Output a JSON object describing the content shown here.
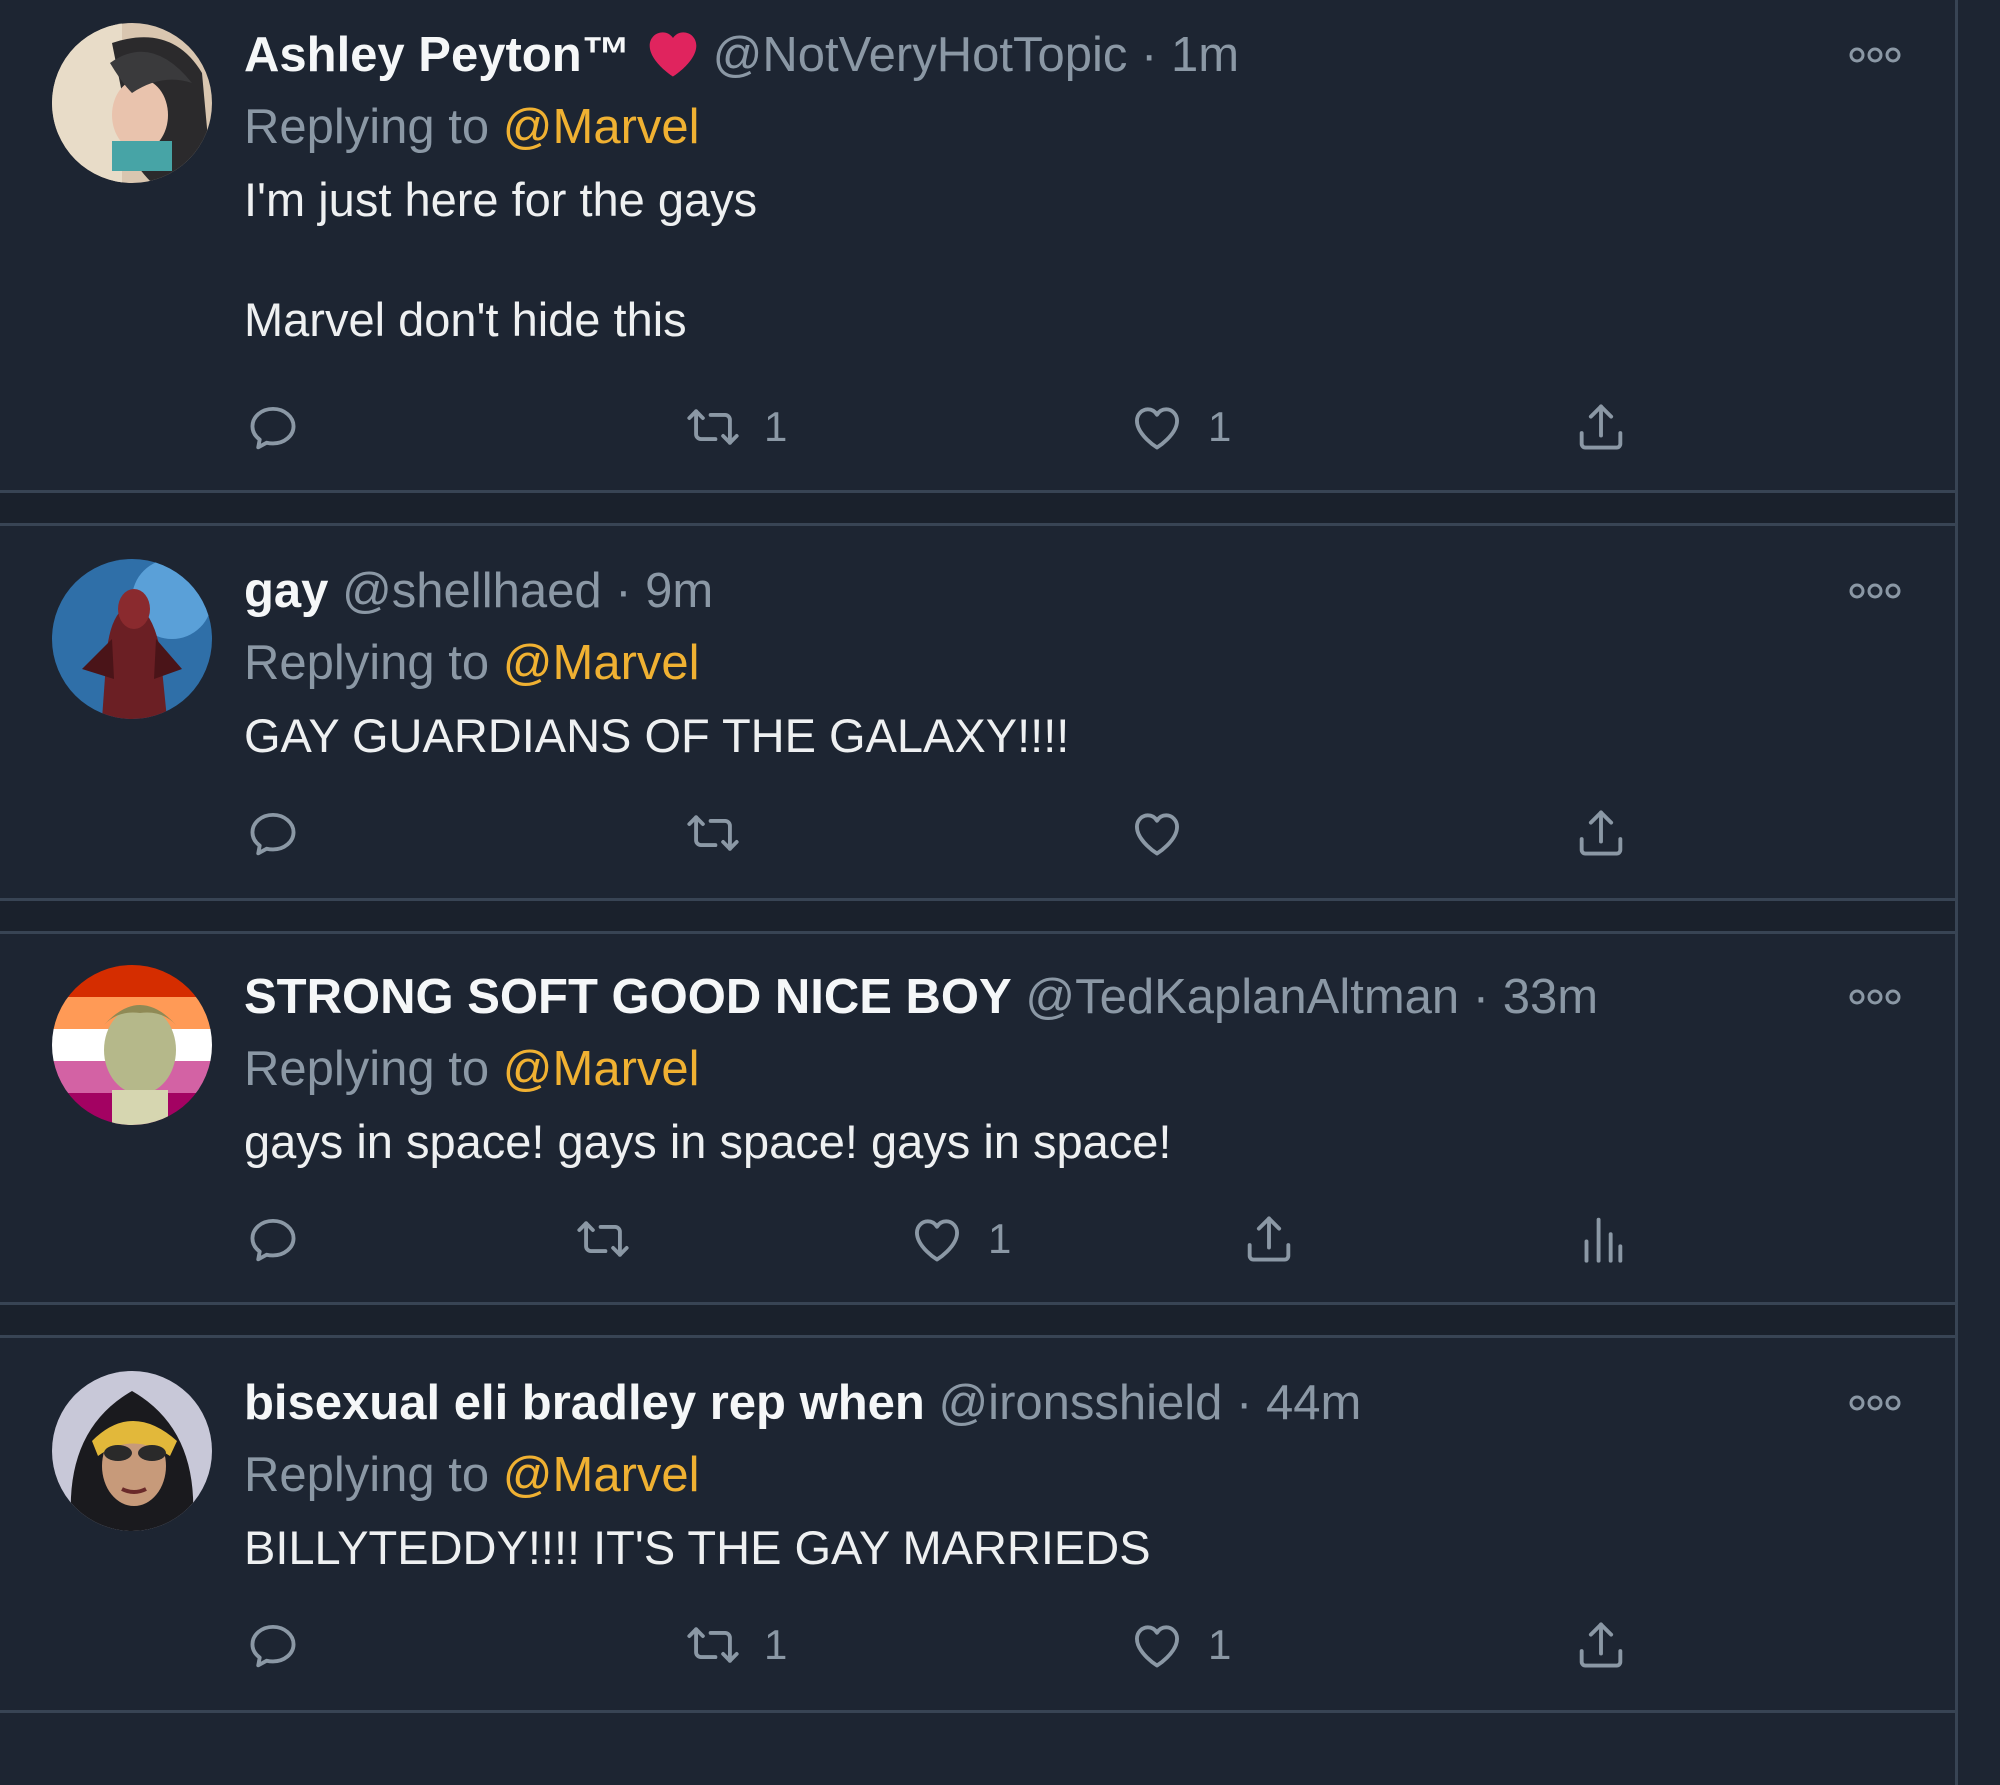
{
  "tweets": [
    {
      "name": "Ashley Peyton™",
      "has_heart_badge": true,
      "handle": "@NotVeryHotTopic",
      "dot": "·",
      "time": "1m",
      "replying_prefix": "Replying to",
      "replying_to": "@Marvel",
      "text": "I'm just here for the gays\n\nMarvel don't hide this",
      "retweets": "1",
      "likes": "1"
    },
    {
      "name": "gay",
      "handle": "@shellhaed",
      "dot": "·",
      "time": "9m",
      "replying_prefix": "Replying to",
      "replying_to": "@Marvel",
      "text": "GAY GUARDIANS OF THE GALAXY!!!!",
      "retweets": "",
      "likes": ""
    },
    {
      "name": "STRONG SOFT GOOD NICE BOY",
      "handle": "@TedKaplanAltman",
      "dot": "·",
      "time": "33m",
      "replying_prefix": "Replying to",
      "replying_to": "@Marvel",
      "text": "gays in space! gays in space! gays in space!",
      "retweets": "",
      "likes": "1"
    },
    {
      "name": "bisexual eli bradley rep when",
      "handle": "@ironsshield",
      "dot": "·",
      "time": "44m",
      "replying_prefix": "Replying to",
      "replying_to": "@Marvel",
      "text": "BILLYTEDDY!!!! IT'S THE GAY MARRIEDS",
      "retweets": "1",
      "likes": "1"
    }
  ],
  "colors": {
    "background": "#1d2532",
    "mention": "#f0b132",
    "muted": "#8b98a5",
    "heart_badge": "#e0245e"
  },
  "icons": [
    "reply-icon",
    "retweet-icon",
    "like-icon",
    "share-icon",
    "analytics-icon",
    "more-icon"
  ]
}
